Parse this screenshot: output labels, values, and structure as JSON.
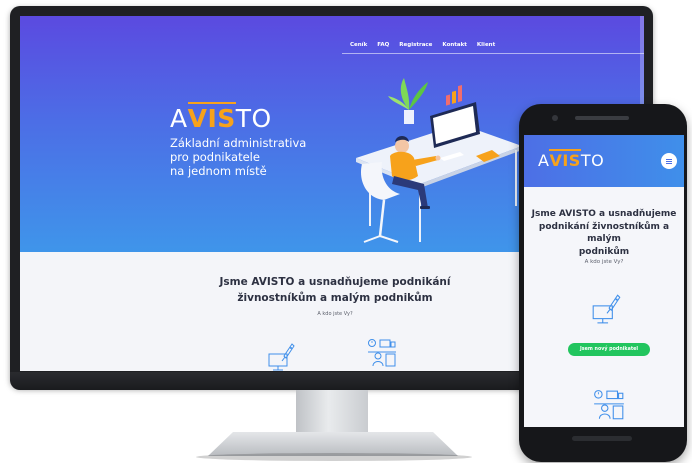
{
  "desktop": {
    "nav": {
      "items": [
        "Ceník",
        "FAQ",
        "Registrace",
        "Kontakt",
        "Klient"
      ]
    },
    "hero": {
      "logo": {
        "pre": "A",
        "accent": "VIS",
        "post": "TO"
      },
      "tagline": [
        "Základní administrativa",
        "pro podnikatele",
        "na jednom místě"
      ]
    },
    "content": {
      "title_lines": [
        "Jsme AVISTO a usnadňujeme podnikání",
        "živnostníkům a malým podnikům"
      ],
      "subtitle": "A kdo jste Vy?"
    }
  },
  "phone": {
    "header": {
      "logo": {
        "pre": "A",
        "accent": "VIS",
        "post": "TO"
      }
    },
    "content": {
      "title_lines": [
        "Jsme AVISTO a usnadňujeme",
        "podnikání živnostníkům a malým",
        "podnikům"
      ],
      "subtitle": "A kdo jste Vy?",
      "cta_label": "Jsem nový podnikatel"
    }
  },
  "colors": {
    "hero_gradient_top": "#5b4ae0",
    "hero_gradient_bottom": "#3f95ea",
    "logo_accent": "#f7a21b",
    "cta_green": "#22c55e",
    "icon_blue": "#3f8fea",
    "text_dark": "#2d3142"
  },
  "icons": [
    "rocket-monitor-icon",
    "office-desk-icon",
    "menu-icon",
    "desk-worker-illustration"
  ]
}
